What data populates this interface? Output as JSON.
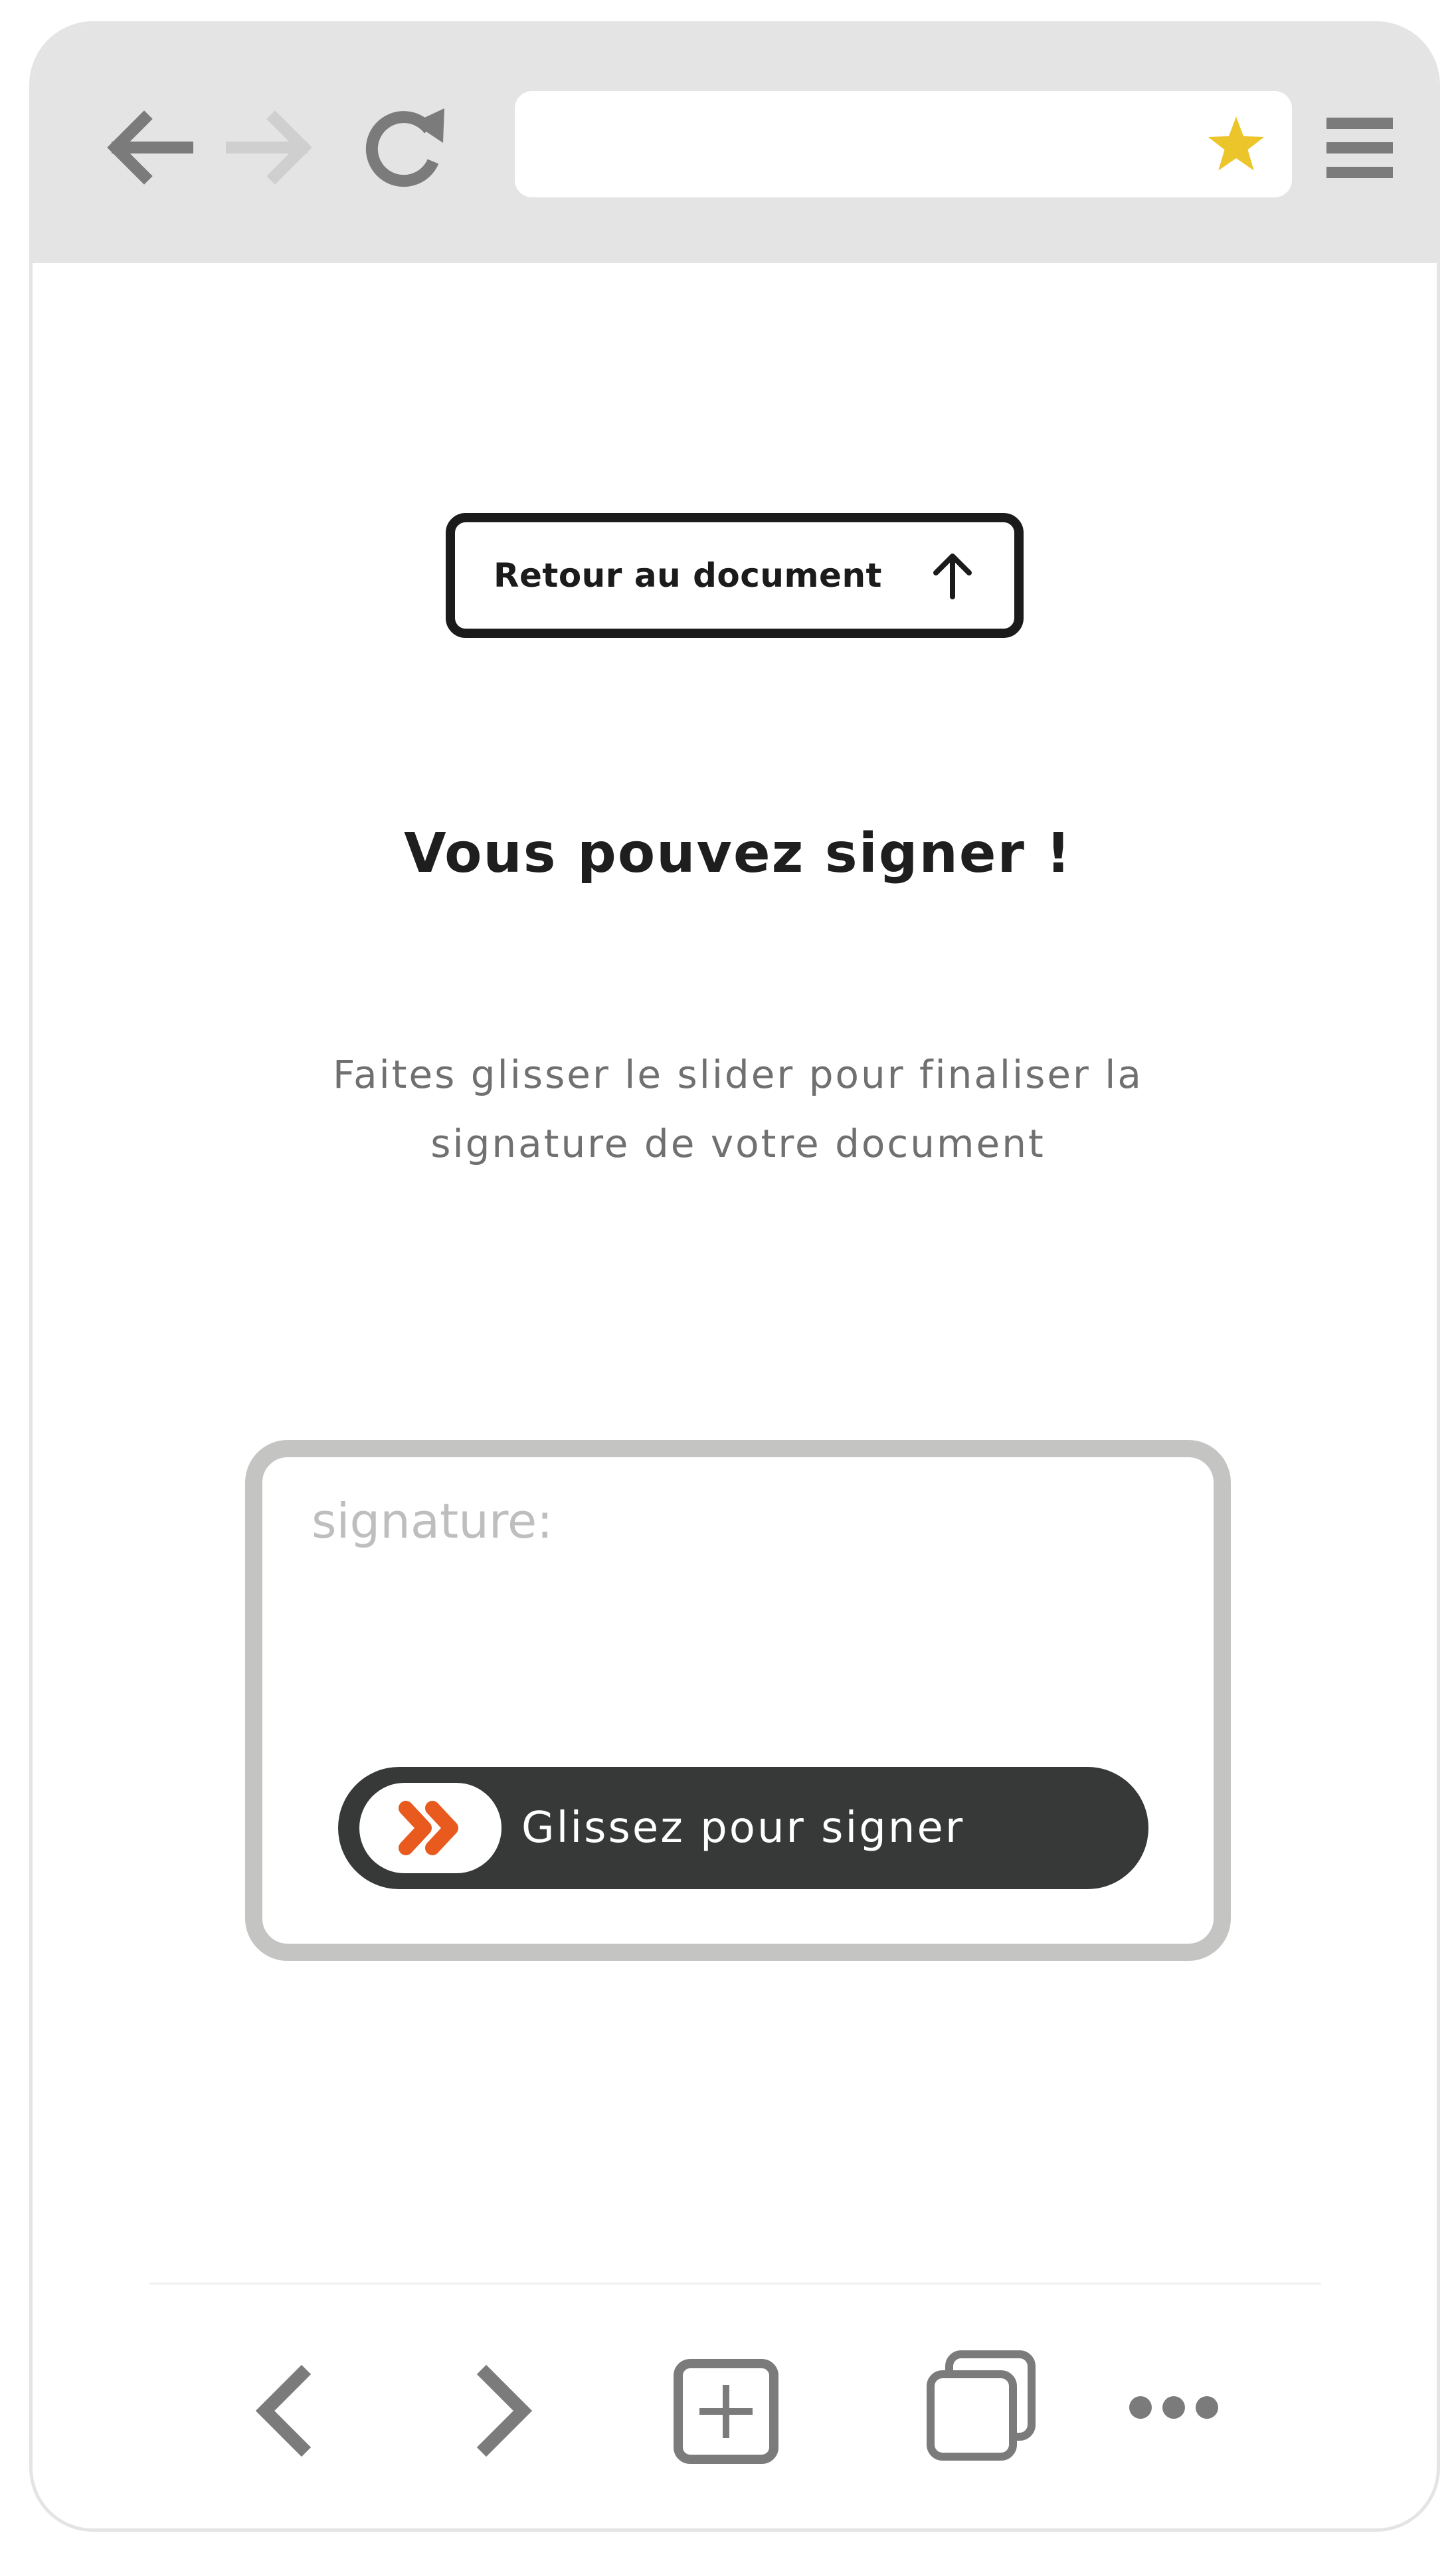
{
  "browser": {
    "toolbar": {
      "back_icon": "arrow-left-icon",
      "forward_icon": "arrow-right-icon",
      "reload_icon": "reload-icon",
      "url_value": "",
      "bookmark_icon": "star-icon",
      "menu_icon": "hamburger-menu-icon"
    },
    "bottom_bar": {
      "icons": [
        "chevron-left-icon",
        "chevron-right-icon",
        "new-tab-icon",
        "tabs-icon",
        "more-icon"
      ]
    }
  },
  "page": {
    "back_button_label": "Retour au document",
    "back_button_icon": "arrow-up-icon",
    "title": "Vous pouvez signer !",
    "subtitle_line1": "Faites glisser le slider pour finaliser la",
    "subtitle_line2": "signature de votre document",
    "signature": {
      "label": "signature:",
      "slider_label": "Glissez pour signer",
      "slider_icon": "double-chevron-right-icon"
    }
  },
  "colors": {
    "toolbar_bg": "#e4e4e4",
    "star": "#ebc52a",
    "slider_bg": "#373938",
    "accent_orange": "#e85a1d",
    "signature_border": "#c4c4c2",
    "icon_gray": "#7b7b7b"
  }
}
